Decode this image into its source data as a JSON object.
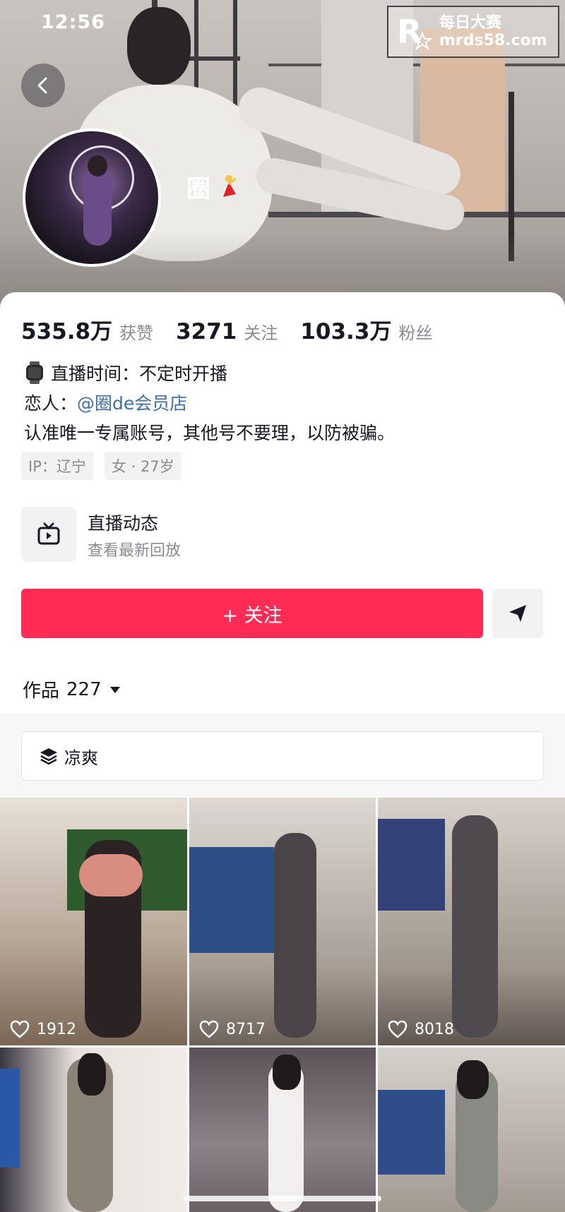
{
  "status_bar": {
    "time": "12:56"
  },
  "watermark": {
    "title": "每日大赛",
    "url": "mrds58.com",
    "logo_letter": "R"
  },
  "profile": {
    "nickname": "圈",
    "stats": [
      {
        "value": "535.8万",
        "label": "获赞"
      },
      {
        "value": "3271",
        "label": "关注"
      },
      {
        "value": "103.3万",
        "label": "粉丝"
      }
    ],
    "bio": {
      "live_time": "直播时间：不定时开播",
      "lover_prefix": "恋人：",
      "lover_mention": "@圈de会员店",
      "notice": "认准唯一专属账号，其他号不要理，以防被骗。"
    },
    "tags": [
      "IP：辽宁",
      "女 · 27岁"
    ],
    "live_entry": {
      "title": "直播动态",
      "subtitle": "查看最新回放"
    },
    "follow_label": "+ 关注",
    "works": {
      "label": "作品",
      "count": "227"
    },
    "collection": "凉爽"
  },
  "videos": [
    {
      "likes": "1912"
    },
    {
      "likes": "8717"
    },
    {
      "likes": "8018"
    },
    {
      "likes": ""
    },
    {
      "likes": ""
    },
    {
      "likes": ""
    }
  ],
  "colors": {
    "accent": "#fe2c55",
    "mention": "#3d6fa8"
  },
  "icons": [
    "back-arrow-icon",
    "watch-icon",
    "live-tv-icon",
    "share-send-icon",
    "dropdown-triangle-icon",
    "layers-icon",
    "heart-outline-icon"
  ]
}
